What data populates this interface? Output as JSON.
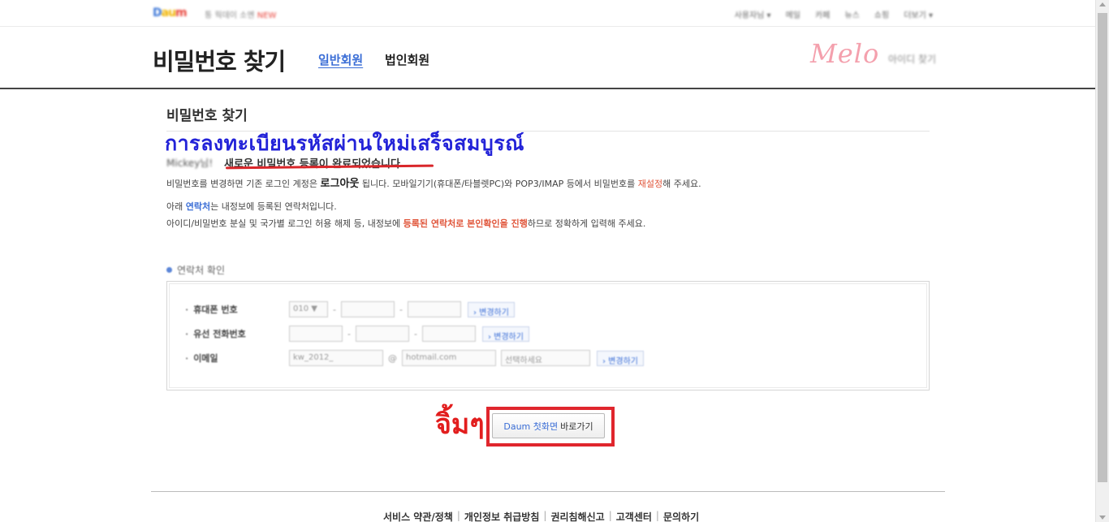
{
  "topbar": {
    "logo_parts": [
      "D",
      "au",
      "",
      "m"
    ],
    "left_link": "통 웍데이 소멘",
    "left_new": "NEW",
    "nav": [
      "사용자님 ▾",
      "메일",
      "카페",
      "뉴스",
      "쇼핑",
      "더보기 ▾"
    ]
  },
  "header": {
    "title": "비밀번호 찾기",
    "tabs": [
      {
        "label": "일반회원",
        "active": true
      },
      {
        "label": "법인회원",
        "active": false
      }
    ],
    "melo_logo": "Melo",
    "find_id": "아이디 찾기"
  },
  "content": {
    "section_title": "비밀번호 찾기",
    "thai_title": "การลงทะเบียนรหัสผ่านใหม่เสร็จสมบูรณ์",
    "user_name": "Mickey님!",
    "main_message": "새로운 비밀번호 등록이 완료되었습니다.",
    "p1_a": "비밀번호를 변경하면 기존 로그인 계정은 ",
    "p1_b": "로그아웃",
    "p1_c": " 됩니다. 모바일기기(휴대폰/타블렛PC)와 POP3/IMAP 등에서 비밀번호를 ",
    "p1_d": "재설정",
    "p1_e": "해 주세요.",
    "p2_a": "아래 ",
    "p2_b": "연락처",
    "p2_c": "는 내정보에 등록된 연락처입니다.",
    "p3_a": "아이디/비밀번호 분실 및 국가별 로그인 허용 해제 등, 내정보에 ",
    "p3_b": "등록된 연락처로 본인확인을 진행",
    "p3_c": "하므로 정확하게 입력해 주세요."
  },
  "contact": {
    "heading": "연락처 확인",
    "rows": [
      {
        "label": "휴대폰 번호",
        "prefix": "010 ▼",
        "change": "› 변경하기"
      },
      {
        "label": "유선 전화번호",
        "change": "› 변경하기"
      },
      {
        "label": "이메일",
        "email_id": "kw_2012_",
        "at": "@",
        "domain": "hotmail.com",
        "select": "선택하세요",
        "change": "› 변경하기"
      }
    ]
  },
  "annotation": {
    "thai_poke": "จิ้มๆ"
  },
  "button": {
    "daum_part": "Daum 첫화면",
    "go_part": "바로가기"
  },
  "footer": {
    "links": [
      "서비스 약관/정책",
      "개인정보 취급방침",
      "권리침해신고",
      "고객센터",
      "문의하기"
    ]
  },
  "colors": {
    "accent_blue": "#3b6ed6",
    "highlight_red": "#e0262d",
    "thai_blue": "#2323d8"
  }
}
